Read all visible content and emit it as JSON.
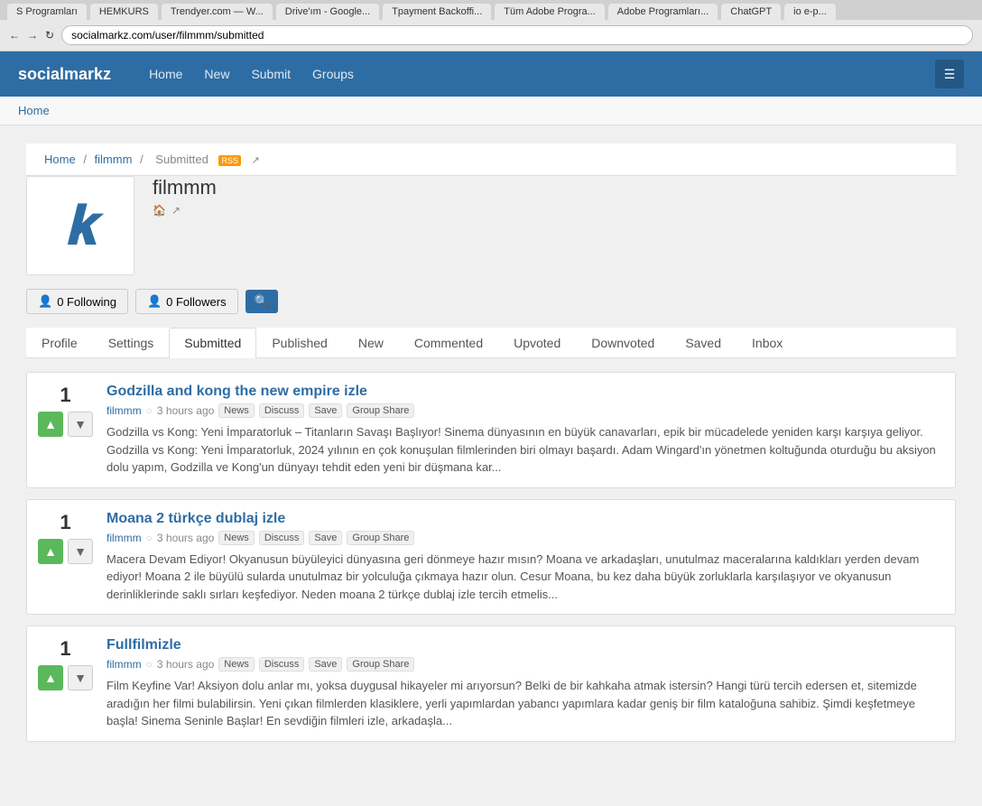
{
  "browser": {
    "url": "socialmarkz.com/user/filmmm/submitted",
    "tabs": [
      {
        "label": "S Programları",
        "active": false
      },
      {
        "label": "HEMKURS",
        "active": false
      },
      {
        "label": "Trendyer.com — W...",
        "active": false
      },
      {
        "label": "Drive'ım - Google...",
        "active": false
      },
      {
        "label": "Tpayment Backoffi...",
        "active": false
      },
      {
        "label": "Tüm Adobe Progra...",
        "active": false
      },
      {
        "label": "Adobe Programları...",
        "active": false
      },
      {
        "label": "ChatGPT",
        "active": false
      },
      {
        "label": "io e-p...",
        "active": false
      }
    ]
  },
  "nav": {
    "brand": "socialmarkz",
    "links": [
      "Home",
      "New",
      "Submit",
      "Groups"
    ]
  },
  "breadcrumb_bar": {
    "label": "Home"
  },
  "breadcrumb_page": {
    "home": "Home",
    "user": "filmmm",
    "section": "Submitted"
  },
  "profile": {
    "username": "filmmm",
    "avatar_letter": "k",
    "home_icon": "🏠",
    "external_icon": "↗"
  },
  "follow_bar": {
    "following_label": "0 Following",
    "followers_label": "0 Followers",
    "search_icon": "🔍"
  },
  "tabs": [
    {
      "label": "Profile",
      "active": false
    },
    {
      "label": "Settings",
      "active": false
    },
    {
      "label": "Submitted",
      "active": true
    },
    {
      "label": "Published",
      "active": false
    },
    {
      "label": "New",
      "active": false
    },
    {
      "label": "Commented",
      "active": false
    },
    {
      "label": "Upvoted",
      "active": false
    },
    {
      "label": "Downvoted",
      "active": false
    },
    {
      "label": "Saved",
      "active": false
    },
    {
      "label": "Inbox",
      "active": false
    }
  ],
  "posts": [
    {
      "id": 1,
      "vote_count": "1",
      "title": "Godzilla and kong the new empire izle",
      "author": "filmmm",
      "time": "3 hours ago",
      "category": "News",
      "discuss": "Discuss",
      "save": "Save",
      "group": "Group",
      "share": "Share",
      "excerpt": "Godzilla vs Kong: Yeni İmparatorluk – Titanların Savaşı Başlıyor! Sinema dünyasının en büyük canavarları, epik bir mücadelede yeniden karşı karşıya geliyor. Godzilla vs Kong: Yeni İmparatorluk, 2024 yılının en çok konuşulan filmlerinden biri olmayı başardı. Adam Wingard'ın yönetmen koltuğunda oturduğu bu aksiyon dolu yapım, Godzilla ve Kong'un dünyayı tehdit eden yeni bir düşmana kar..."
    },
    {
      "id": 2,
      "vote_count": "1",
      "title": "Moana 2 türkçe dublaj izle",
      "author": "filmmm",
      "time": "3 hours ago",
      "category": "News",
      "discuss": "Discuss",
      "save": "Save",
      "group": "Group",
      "share": "Share",
      "excerpt": "Macera Devam Ediyor! Okyanusun büyüleyici dünyasına geri dönmeye hazır mısın? Moana ve arkadaşları, unutulmaz maceralarına kaldıkları yerden devam ediyor! Moana 2 ile büyülü sularda unutulmaz bir yolculuğa çıkmaya hazır olun. Cesur Moana, bu kez daha büyük zorluklarla karşılaşıyor ve okyanusun derinliklerinde saklı sırları keşfediyor. Neden moana 2 türkçe dublaj izle tercih etmelis..."
    },
    {
      "id": 3,
      "vote_count": "1",
      "title": "Fullfilmizle",
      "author": "filmmm",
      "time": "3 hours ago",
      "category": "News",
      "discuss": "Discuss",
      "save": "Save",
      "group": "Group",
      "share": "Share",
      "excerpt": "Film Keyfine Var! Aksiyon dolu anlar mı, yoksa duygusal hikayeler mi arıyorsun? Belki de bir kahkaha atmak istersin? Hangi türü tercih edersen et, sitemizde aradığın her filmi bulabilirsin. Yeni çıkan filmlerden klasiklere, yerli yapımlardan yabancı yapımlara kadar geniş bir film kataloğuna sahibiz. Şimdi keşfetmeye başla! Sinema Seninle Başlar! En sevdiğin filmleri izle, arkadaşla..."
    }
  ]
}
